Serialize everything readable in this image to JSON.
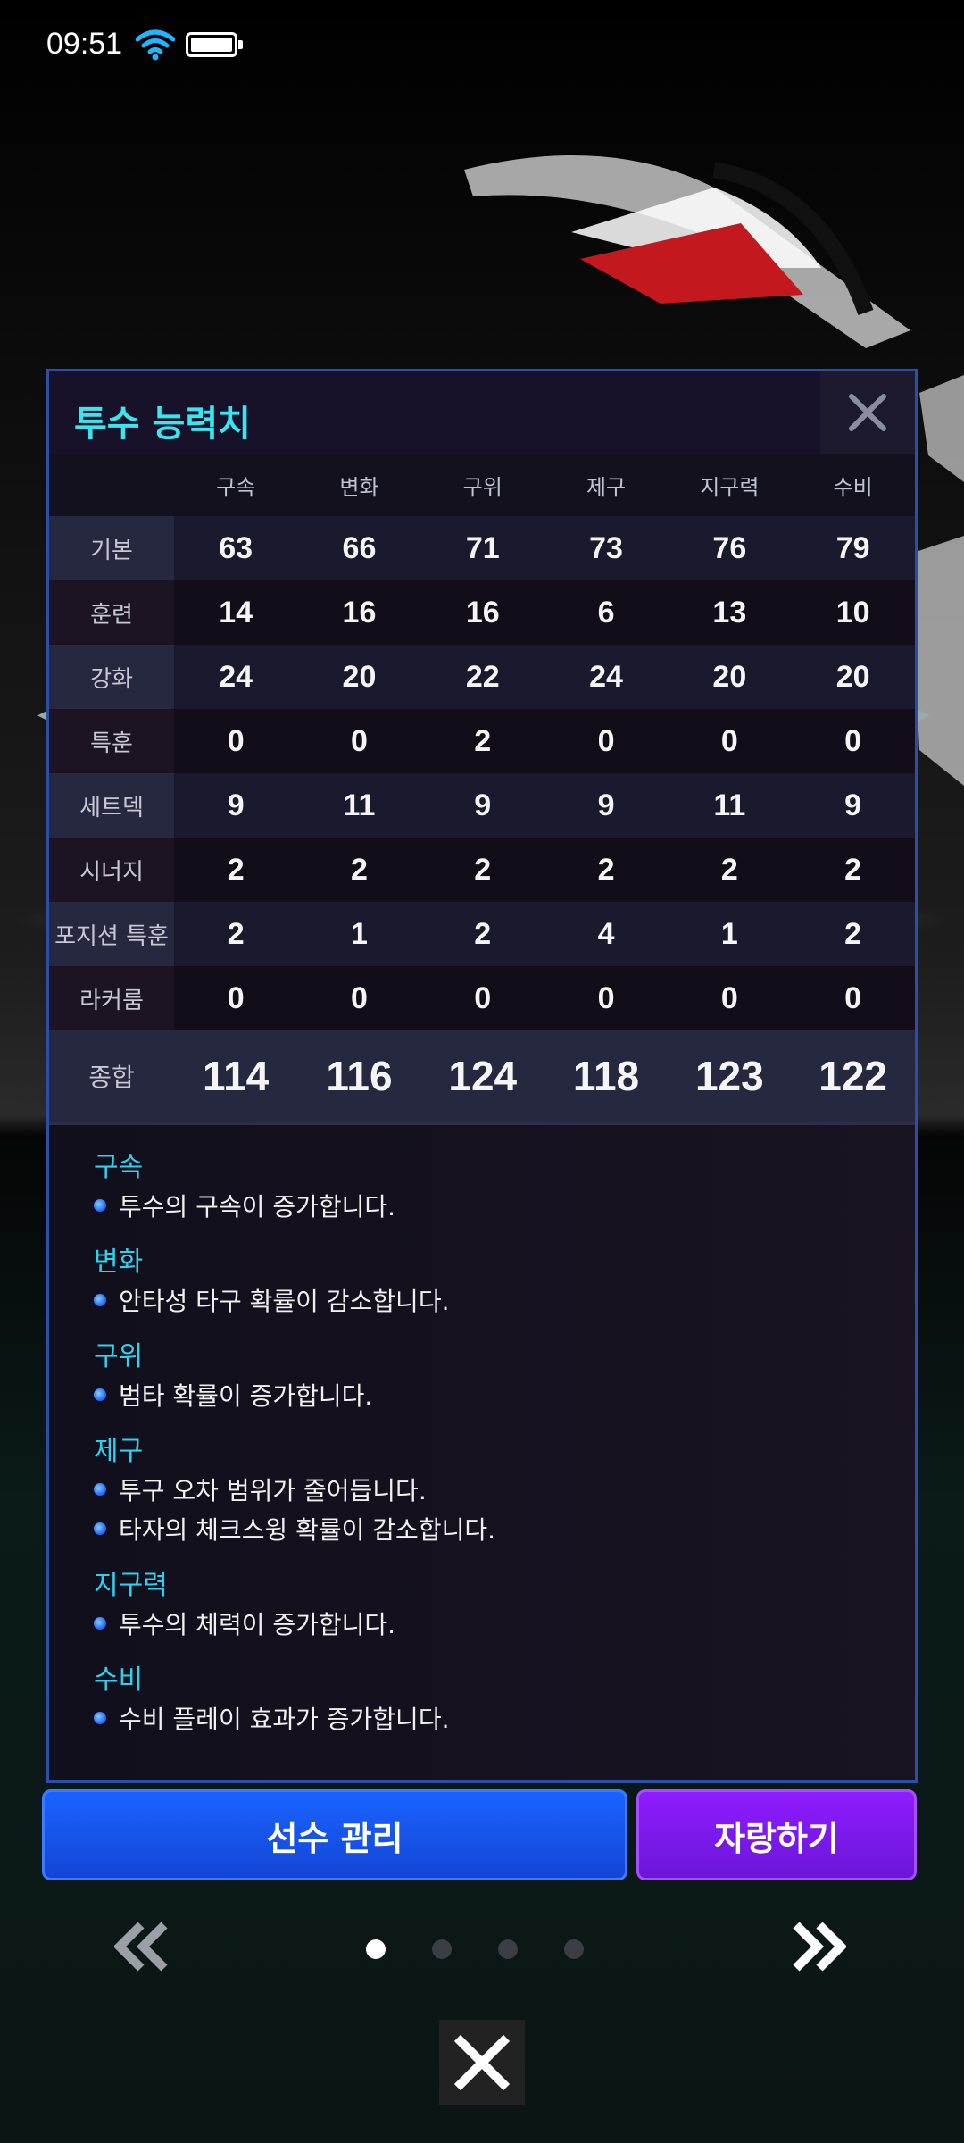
{
  "status_bar": {
    "time": "09:51"
  },
  "panel": {
    "title": "투수 능력치",
    "columns": [
      "구속",
      "변화",
      "구위",
      "제구",
      "지구력",
      "수비"
    ],
    "rows": [
      {
        "label": "기본",
        "values": [
          "63",
          "66",
          "71",
          "73",
          "76",
          "79"
        ]
      },
      {
        "label": "훈련",
        "values": [
          "14",
          "16",
          "16",
          "6",
          "13",
          "10"
        ]
      },
      {
        "label": "강화",
        "values": [
          "24",
          "20",
          "22",
          "24",
          "20",
          "20"
        ]
      },
      {
        "label": "특훈",
        "values": [
          "0",
          "0",
          "2",
          "0",
          "0",
          "0"
        ]
      },
      {
        "label": "세트덱",
        "values": [
          "9",
          "11",
          "9",
          "9",
          "11",
          "9"
        ]
      },
      {
        "label": "시너지",
        "values": [
          "2",
          "2",
          "2",
          "2",
          "2",
          "2"
        ]
      },
      {
        "label": "포지션 특훈",
        "values": [
          "2",
          "1",
          "2",
          "4",
          "1",
          "2"
        ]
      },
      {
        "label": "라커룸",
        "values": [
          "0",
          "0",
          "0",
          "0",
          "0",
          "0"
        ]
      }
    ],
    "total": {
      "label": "종합",
      "values": [
        "114",
        "116",
        "124",
        "118",
        "123",
        "122"
      ]
    },
    "descriptions": [
      {
        "title": "구속",
        "lines": [
          "투수의 구속이 증가합니다."
        ]
      },
      {
        "title": "변화",
        "lines": [
          "안타성 타구 확률이 감소합니다."
        ]
      },
      {
        "title": "구위",
        "lines": [
          "범타 확률이 증가합니다."
        ]
      },
      {
        "title": "제구",
        "lines": [
          "투구 오차 범위가 줄어듭니다.",
          "타자의 체크스윙 확률이 감소합니다."
        ]
      },
      {
        "title": "지구력",
        "lines": [
          "투수의 체력이 증가합니다."
        ]
      },
      {
        "title": "수비",
        "lines": [
          "수비 플레이 효과가 증가합니다."
        ]
      }
    ]
  },
  "buttons": {
    "manage_label": "선수 관리",
    "show_off_label": "자랑하기"
  },
  "pager": {
    "total": 4,
    "current": 1
  },
  "colors": {
    "title_cyan": "#39e6f0",
    "desc_title_cyan": "#2dd2f0",
    "manage_blue": "#1a63ff",
    "show_off_purple": "#8f1cff"
  },
  "icons": {
    "close": "close-icon",
    "prev": "double-chevron-left-icon",
    "next": "double-chevron-right-icon"
  }
}
